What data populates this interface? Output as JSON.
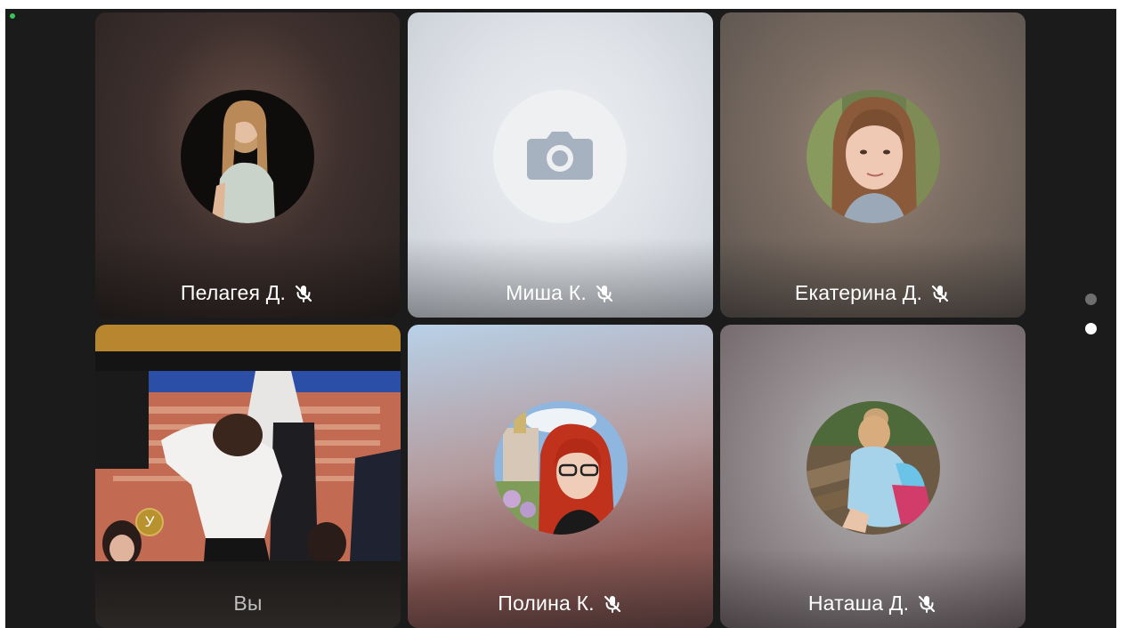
{
  "participants": [
    {
      "name": "Пелагея Д.",
      "muted": true,
      "video": false,
      "avatar": "photo"
    },
    {
      "name": "Миша К.",
      "muted": true,
      "video": false,
      "avatar": "camera-placeholder-icon"
    },
    {
      "name": "Екатерина Д.",
      "muted": true,
      "video": false,
      "avatar": "photo"
    },
    {
      "name": "Вы",
      "muted": false,
      "video": true,
      "badge": "У"
    },
    {
      "name": "Полина К.",
      "muted": true,
      "video": false,
      "avatar": "photo"
    },
    {
      "name": "Наташа Д.",
      "muted": true,
      "video": false,
      "avatar": "photo"
    }
  ],
  "pagination": {
    "pages": 2,
    "current": 2
  },
  "icons": {
    "muted": "mic-off-icon",
    "placeholder": "camera-icon"
  },
  "colors": {
    "background": "#1b1b1b",
    "active_dot": "#ffffff",
    "inactive_dot": "#6e6e6e",
    "badge": "#b8922f"
  }
}
